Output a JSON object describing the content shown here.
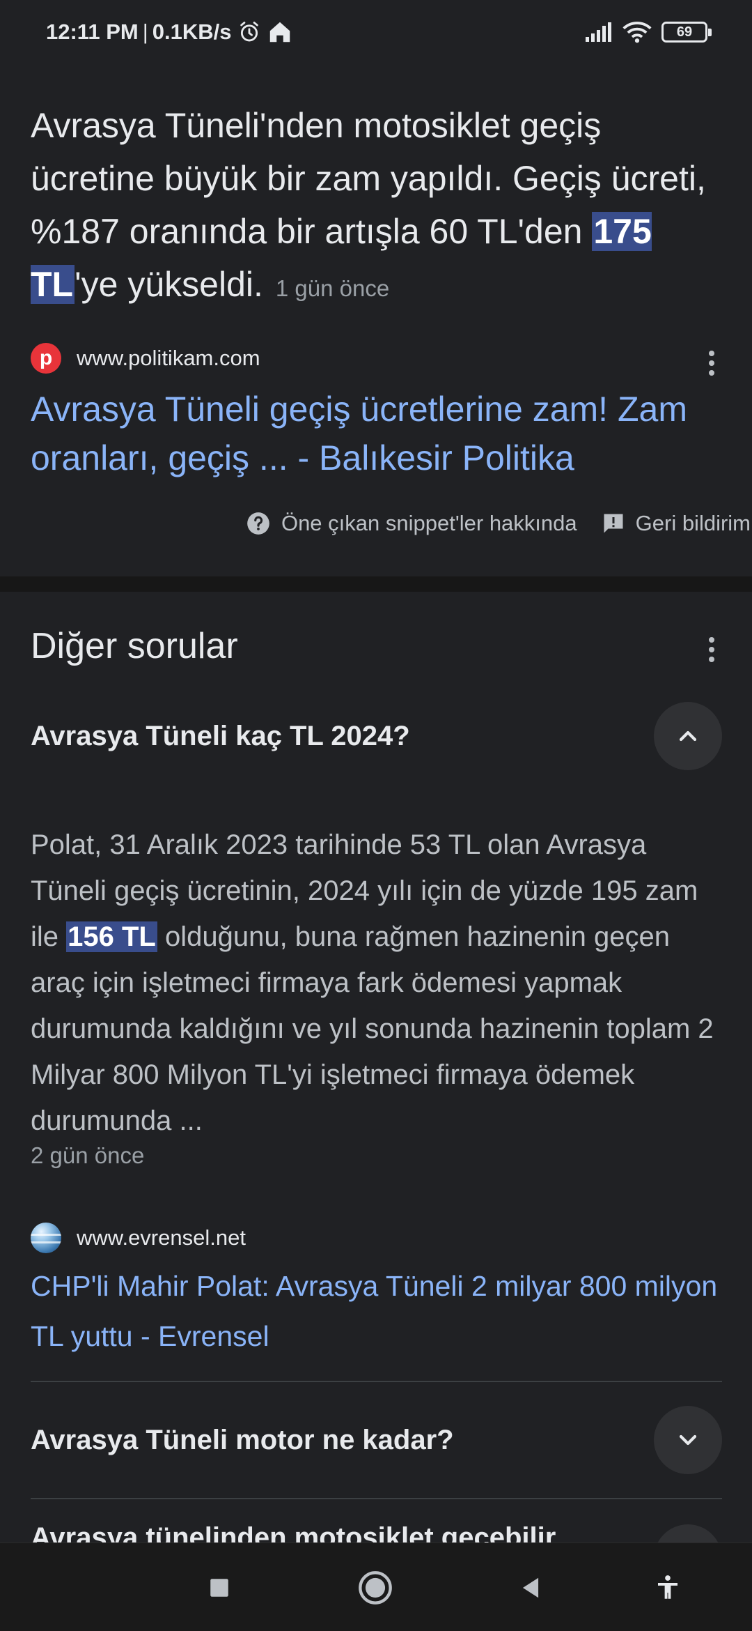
{
  "status_bar": {
    "time": "12:11 PM",
    "separator": "|",
    "net_speed": "0.1KB/s",
    "battery": "69",
    "icons": [
      "alarm-icon",
      "home-icon",
      "signal-icon",
      "wifi-icon",
      "battery-icon"
    ]
  },
  "snippet": {
    "text_before": "Avrasya Tüneli'nden motosiklet geçiş ücretine büyük bir zam yapıldı. Geçiş ücreti, %187 oranında bir artışla 60 TL'den ",
    "highlight": "175 TL",
    "text_after": "'ye yükseldi.",
    "time": "1 gün önce",
    "source_icon_letter": "p",
    "source_url": "www.politikam.com",
    "link_title": "Avrasya Tüneli geçiş ücretlerine zam! Zam oranları, geçiş ... - Balıkesir Politika",
    "footer_about": "Öne çıkan snippet'ler hakkında",
    "footer_feedback": "Geri bildirim"
  },
  "paa": {
    "title": "Diğer sorular",
    "questions": [
      {
        "text": "Avrasya Tüneli kaç TL 2024?",
        "expanded": true,
        "answer_before": "Polat, 31 Aralık 2023 tarihinde 53 TL olan Avrasya Tüneli geçiş ücretinin, 2024 yılı için de yüzde 195 zam ile ",
        "answer_highlight": "156 TL",
        "answer_after": " olduğunu, buna rağmen hazinenin geçen araç için işletmeci firmaya fark ödemesi yapmak durumunda kaldığını ve yıl sonunda hazinenin toplam 2 Milyar 800 Milyon TL'yi işletmeci firmaya ödemek durumunda ...",
        "time": "2 gün önce",
        "source_url": "www.evrensel.net",
        "link_title": "CHP'li Mahir Polat: Avrasya Tüneli 2 milyar 800 milyon TL yuttu - Evrensel"
      },
      {
        "text": "Avrasya Tüneli motor ne kadar?",
        "expanded": false
      },
      {
        "text": "Avrasya tünelinden motosiklet geçebilir",
        "expanded": false
      }
    ]
  },
  "colors": {
    "background": "#202124",
    "link": "#8ab4f8",
    "highlight": "#394d8c",
    "muted": "#9aa0a6"
  }
}
